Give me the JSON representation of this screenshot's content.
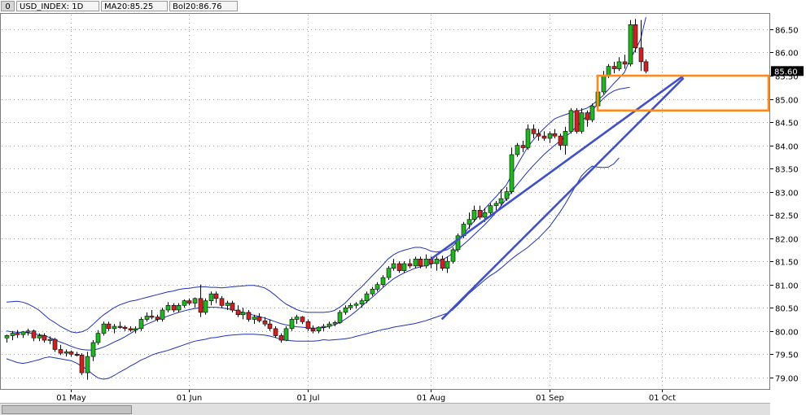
{
  "header": {
    "symbol_icon": "0",
    "symbol": "USD_INDEX: 1D",
    "ma": "MA20:85.25",
    "bol": "Bol20:86.76"
  },
  "colors": {
    "background": "#ffffff",
    "grid": "#a0a0a0",
    "band": "#1f32b4",
    "candle_up": "#22b422",
    "candle_down": "#cc2222",
    "channel": "#4050c8",
    "zone": "#ff8a1a",
    "price_tag": "#000000"
  },
  "chart_data": {
    "type": "candlestick",
    "instrument": "USD_INDEX",
    "timeframe": "1D",
    "ylim": [
      78.75,
      86.85
    ],
    "y_ticks": [
      79.0,
      79.5,
      80.0,
      80.5,
      81.0,
      81.5,
      82.0,
      82.5,
      83.0,
      83.5,
      84.0,
      84.5,
      85.0,
      85.5,
      86.0,
      86.5
    ],
    "y_tick_labels": [
      "79.00",
      "79.50",
      "80.00",
      "80.50",
      "81.00",
      "81.50",
      "82.00",
      "82.50",
      "83.00",
      "83.50",
      "84.00",
      "84.50",
      "85.00",
      "85.50",
      "86.00",
      "86.50"
    ],
    "x_ticks": [
      {
        "label": "01 May",
        "index": 12
      },
      {
        "label": "01 Jun",
        "index": 34
      },
      {
        "label": "01 Jul",
        "index": 56
      },
      {
        "label": "01 Aug",
        "index": 79
      },
      {
        "label": "01 Sep",
        "index": 101
      },
      {
        "label": "01 Oct",
        "index": 122
      }
    ],
    "last_price": "85.60",
    "candles": [
      [
        79.85,
        79.92,
        79.75,
        79.9
      ],
      [
        79.9,
        80.0,
        79.8,
        79.95
      ],
      [
        79.95,
        80.02,
        79.85,
        79.92
      ],
      [
        79.92,
        80.0,
        79.85,
        79.98
      ],
      [
        79.98,
        80.05,
        79.9,
        80.0
      ],
      [
        80.0,
        80.03,
        79.78,
        79.85
      ],
      [
        79.85,
        79.95,
        79.78,
        79.9
      ],
      [
        79.9,
        79.95,
        79.75,
        79.8
      ],
      [
        79.8,
        79.88,
        79.72,
        79.82
      ],
      [
        79.82,
        79.85,
        79.55,
        79.6
      ],
      [
        79.6,
        79.7,
        79.48,
        79.52
      ],
      [
        79.52,
        79.6,
        79.45,
        79.55
      ],
      [
        79.55,
        79.58,
        79.45,
        79.5
      ],
      [
        79.5,
        79.55,
        79.45,
        79.48
      ],
      [
        79.48,
        79.52,
        79.05,
        79.1
      ],
      [
        79.1,
        79.55,
        78.95,
        79.45
      ],
      [
        79.45,
        79.8,
        79.35,
        79.75
      ],
      [
        79.75,
        80.02,
        79.7,
        79.95
      ],
      [
        79.95,
        80.2,
        79.9,
        80.15
      ],
      [
        80.15,
        80.2,
        80.0,
        80.05
      ],
      [
        80.05,
        80.15,
        79.95,
        80.1
      ],
      [
        80.1,
        80.2,
        80.05,
        80.08
      ],
      [
        80.08,
        80.12,
        80.0,
        80.05
      ],
      [
        80.05,
        80.1,
        79.98,
        80.02
      ],
      [
        80.02,
        80.1,
        79.95,
        80.05
      ],
      [
        80.05,
        80.3,
        80.0,
        80.25
      ],
      [
        80.25,
        80.4,
        80.2,
        80.32
      ],
      [
        80.32,
        80.45,
        80.25,
        80.3
      ],
      [
        80.3,
        80.35,
        80.2,
        80.25
      ],
      [
        80.25,
        80.5,
        80.2,
        80.45
      ],
      [
        80.45,
        80.62,
        80.4,
        80.55
      ],
      [
        80.55,
        80.6,
        80.4,
        80.45
      ],
      [
        80.45,
        80.6,
        80.4,
        80.55
      ],
      [
        80.55,
        80.68,
        80.5,
        80.65
      ],
      [
        80.65,
        80.7,
        80.55,
        80.6
      ],
      [
        80.6,
        80.72,
        80.5,
        80.7
      ],
      [
        80.7,
        81.0,
        80.3,
        80.4
      ],
      [
        80.4,
        80.7,
        80.35,
        80.65
      ],
      [
        80.65,
        80.85,
        80.55,
        80.8
      ],
      [
        80.8,
        80.85,
        80.6,
        80.7
      ],
      [
        80.7,
        80.75,
        80.5,
        80.55
      ],
      [
        80.55,
        80.65,
        80.45,
        80.6
      ],
      [
        80.6,
        80.65,
        80.4,
        80.45
      ],
      [
        80.45,
        80.55,
        80.3,
        80.35
      ],
      [
        80.35,
        80.5,
        80.25,
        80.4
      ],
      [
        80.4,
        80.45,
        80.2,
        80.25
      ],
      [
        80.25,
        80.35,
        80.15,
        80.3
      ],
      [
        80.3,
        80.38,
        80.18,
        80.22
      ],
      [
        80.22,
        80.3,
        80.1,
        80.15
      ],
      [
        80.15,
        80.25,
        80.0,
        80.05
      ],
      [
        80.05,
        80.1,
        79.85,
        79.9
      ],
      [
        79.9,
        79.95,
        79.75,
        79.8
      ],
      [
        79.8,
        80.1,
        79.78,
        80.05
      ],
      [
        80.05,
        80.3,
        80.0,
        80.25
      ],
      [
        80.25,
        80.35,
        80.15,
        80.3
      ],
      [
        80.3,
        80.32,
        80.15,
        80.2
      ],
      [
        80.2,
        80.25,
        80.0,
        80.05
      ],
      [
        80.05,
        80.12,
        79.95,
        80.0
      ],
      [
        80.0,
        80.1,
        79.95,
        80.08
      ],
      [
        80.08,
        80.15,
        80.0,
        80.1
      ],
      [
        80.1,
        80.2,
        80.05,
        80.15
      ],
      [
        80.15,
        80.22,
        80.1,
        80.18
      ],
      [
        80.18,
        80.45,
        80.15,
        80.4
      ],
      [
        80.4,
        80.55,
        80.35,
        80.5
      ],
      [
        80.5,
        80.6,
        80.45,
        80.55
      ],
      [
        80.55,
        80.62,
        80.48,
        80.58
      ],
      [
        80.58,
        80.7,
        80.5,
        80.65
      ],
      [
        80.65,
        80.85,
        80.6,
        80.8
      ],
      [
        80.8,
        80.95,
        80.75,
        80.9
      ],
      [
        80.9,
        81.05,
        80.85,
        81.0
      ],
      [
        81.0,
        81.2,
        80.95,
        81.15
      ],
      [
        81.15,
        81.4,
        81.1,
        81.35
      ],
      [
        81.35,
        81.55,
        81.3,
        81.45
      ],
      [
        81.45,
        81.5,
        81.25,
        81.3
      ],
      [
        81.3,
        81.5,
        81.25,
        81.45
      ],
      [
        81.45,
        81.55,
        81.35,
        81.4
      ],
      [
        81.4,
        81.6,
        81.35,
        81.55
      ],
      [
        81.55,
        81.6,
        81.35,
        81.4
      ],
      [
        81.4,
        81.65,
        81.35,
        81.55
      ],
      [
        81.55,
        81.6,
        81.35,
        81.45
      ],
      [
        81.45,
        81.6,
        81.3,
        81.55
      ],
      [
        81.55,
        81.62,
        81.3,
        81.35
      ],
      [
        81.35,
        81.6,
        81.25,
        81.5
      ],
      [
        81.5,
        81.8,
        81.45,
        81.75
      ],
      [
        81.75,
        82.1,
        81.7,
        82.05
      ],
      [
        82.05,
        82.35,
        82.0,
        82.3
      ],
      [
        82.3,
        82.55,
        82.2,
        82.4
      ],
      [
        82.4,
        82.7,
        82.35,
        82.6
      ],
      [
        82.6,
        82.7,
        82.4,
        82.45
      ],
      [
        82.45,
        82.65,
        82.35,
        82.55
      ],
      [
        82.55,
        82.75,
        82.45,
        82.7
      ],
      [
        82.7,
        82.8,
        82.6,
        82.75
      ],
      [
        82.75,
        83.05,
        82.7,
        82.85
      ],
      [
        82.85,
        83.1,
        82.8,
        83.0
      ],
      [
        83.0,
        83.95,
        82.95,
        83.8
      ],
      [
        83.8,
        84.05,
        83.75,
        84.0
      ],
      [
        84.0,
        84.1,
        83.85,
        83.95
      ],
      [
        83.95,
        84.45,
        83.9,
        84.35
      ],
      [
        84.35,
        84.45,
        84.15,
        84.25
      ],
      [
        84.25,
        84.35,
        84.1,
        84.2
      ],
      [
        84.2,
        84.3,
        84.1,
        84.15
      ],
      [
        84.15,
        84.3,
        84.05,
        84.25
      ],
      [
        84.25,
        84.35,
        84.15,
        84.2
      ],
      [
        84.2,
        84.25,
        83.9,
        84.0
      ],
      [
        84.0,
        84.4,
        83.8,
        84.3
      ],
      [
        84.3,
        84.8,
        84.25,
        84.75
      ],
      [
        84.75,
        84.8,
        84.25,
        84.3
      ],
      [
        84.3,
        84.8,
        84.25,
        84.7
      ],
      [
        84.7,
        84.75,
        84.4,
        84.55
      ],
      [
        84.55,
        84.9,
        84.5,
        84.85
      ],
      [
        84.85,
        85.2,
        84.8,
        85.15
      ],
      [
        85.15,
        85.6,
        85.1,
        85.5
      ],
      [
        85.5,
        85.75,
        85.45,
        85.7
      ],
      [
        85.7,
        85.8,
        85.55,
        85.65
      ],
      [
        85.65,
        85.9,
        85.6,
        85.8
      ],
      [
        85.8,
        85.95,
        85.65,
        85.75
      ],
      [
        85.75,
        86.7,
        85.7,
        86.6
      ],
      [
        86.6,
        86.72,
        86.0,
        86.1
      ],
      [
        86.1,
        86.7,
        85.6,
        85.8
      ],
      [
        85.8,
        85.85,
        85.55,
        85.6
      ]
    ],
    "bollinger": {
      "upper": [
        80.62,
        80.63,
        80.64,
        80.62,
        80.58,
        80.52,
        80.45,
        80.35,
        80.25,
        80.18,
        80.1,
        80.04,
        79.98,
        79.96,
        79.98,
        80.03,
        80.13,
        80.24,
        80.34,
        80.42,
        80.5,
        80.56,
        80.6,
        80.64,
        80.66,
        80.69,
        80.72,
        80.75,
        80.78,
        80.81,
        80.84,
        80.86,
        80.89,
        80.91,
        80.92,
        80.94,
        80.95,
        80.95,
        80.94,
        80.94,
        80.93,
        80.94,
        80.95,
        80.96,
        80.97,
        80.98,
        80.98,
        80.96,
        80.93,
        80.86,
        80.77,
        80.67,
        80.58,
        80.52,
        80.46,
        80.42,
        80.4,
        80.4,
        80.4,
        80.4,
        80.41,
        80.44,
        80.51,
        80.6,
        80.72,
        80.84,
        80.94,
        81.06,
        81.18,
        81.3,
        81.42,
        81.55,
        81.64,
        81.7,
        81.74,
        81.77,
        81.8,
        81.8,
        81.77,
        81.72,
        81.7,
        81.72,
        81.75,
        81.82,
        81.94,
        82.08,
        82.22,
        82.36,
        82.5,
        82.63,
        82.76,
        82.88,
        83.01,
        83.14,
        83.35,
        83.57,
        83.77,
        83.96,
        84.11,
        84.24,
        84.36,
        84.47,
        84.57,
        84.62,
        84.66,
        84.7,
        84.73,
        84.76,
        84.8,
        84.87,
        84.97,
        85.07,
        85.2,
        85.33,
        85.45,
        85.57,
        85.84,
        86.05,
        86.28,
        86.76
      ],
      "middle": [
        80.0,
        79.98,
        79.97,
        79.97,
        79.96,
        79.94,
        79.92,
        79.9,
        79.86,
        79.81,
        79.76,
        79.72,
        79.67,
        79.63,
        79.6,
        79.59,
        79.59,
        79.61,
        79.65,
        79.7,
        79.76,
        79.81,
        79.87,
        79.94,
        80.01,
        80.08,
        80.14,
        80.19,
        80.24,
        80.28,
        80.32,
        80.36,
        80.4,
        80.43,
        80.46,
        80.48,
        80.5,
        80.51,
        80.51,
        80.51,
        80.5,
        80.48,
        80.46,
        80.43,
        80.4,
        80.37,
        80.34,
        80.31,
        80.28,
        80.24,
        80.2,
        80.16,
        80.13,
        80.11,
        80.09,
        80.08,
        80.07,
        80.06,
        80.06,
        80.07,
        80.1,
        80.13,
        80.18,
        80.25,
        80.33,
        80.42,
        80.52,
        80.62,
        80.72,
        80.82,
        80.93,
        81.03,
        81.12,
        81.19,
        81.25,
        81.3,
        81.35,
        81.38,
        81.41,
        81.44,
        81.48,
        81.53,
        81.59,
        81.67,
        81.76,
        81.86,
        81.96,
        82.07,
        82.18,
        82.29,
        82.41,
        82.54,
        82.69,
        82.84,
        83.0,
        83.15,
        83.29,
        83.43,
        83.56,
        83.68,
        83.8,
        83.9,
        84.0,
        84.09,
        84.18,
        84.28,
        84.39,
        84.51,
        84.63,
        84.76,
        84.88,
        85.0,
        85.1,
        85.17,
        85.21,
        85.23,
        85.25
      ],
      "lower": [
        79.4,
        79.36,
        79.32,
        79.3,
        79.32,
        79.35,
        79.38,
        79.42,
        79.44,
        79.42,
        79.4,
        79.38,
        79.36,
        79.31,
        79.24,
        79.17,
        79.07,
        78.99,
        78.96,
        78.98,
        79.04,
        79.11,
        79.17,
        79.24,
        79.3,
        79.37,
        79.42,
        79.48,
        79.52,
        79.55,
        79.58,
        79.62,
        79.66,
        79.7,
        79.74,
        79.78,
        79.8,
        79.82,
        79.85,
        79.86,
        79.88,
        79.9,
        79.91,
        79.92,
        79.93,
        79.93,
        79.93,
        79.92,
        79.91,
        79.89,
        79.86,
        79.82,
        79.8,
        79.79,
        79.78,
        79.78,
        79.78,
        79.78,
        79.79,
        79.81,
        79.8,
        79.81,
        79.82,
        79.83,
        79.85,
        79.88,
        79.91,
        79.94,
        79.97,
        80.0,
        80.03,
        80.05,
        80.08,
        80.1,
        80.12,
        80.14,
        80.16,
        80.19,
        80.22,
        80.26,
        80.3,
        80.34,
        80.38,
        80.45,
        80.56,
        80.68,
        80.8,
        80.9,
        81.0,
        81.1,
        81.19,
        81.26,
        81.35,
        81.45,
        81.55,
        81.64,
        81.72,
        81.8,
        81.9,
        82.0,
        82.12,
        82.24,
        82.4,
        82.56,
        82.74,
        82.94,
        83.14,
        83.34,
        83.46,
        83.55,
        83.53,
        83.52,
        83.53,
        83.6,
        83.73
      ]
    },
    "channel_upper": {
      "from": [
        79,
        81.55
      ],
      "to": [
        126,
        85.5
      ]
    },
    "channel_lower": {
      "from": [
        81,
        80.25
      ],
      "to": [
        126,
        85.45
      ]
    },
    "resistance_zone": {
      "from_index": 110,
      "y_top": 85.5,
      "y_bottom": 84.75
    },
    "grid": true
  }
}
